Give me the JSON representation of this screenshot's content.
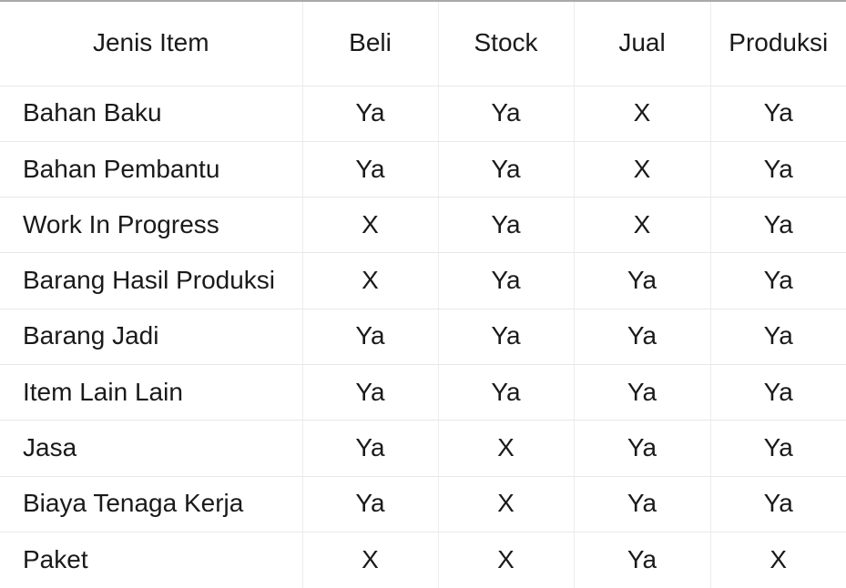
{
  "table": {
    "columns": [
      {
        "key": "label",
        "header": "Jenis Item",
        "align": "left"
      },
      {
        "key": "beli",
        "header": "Beli",
        "align": "center"
      },
      {
        "key": "stock",
        "header": "Stock",
        "align": "center"
      },
      {
        "key": "jual",
        "header": "Jual",
        "align": "center"
      },
      {
        "key": "produksi",
        "header": "Produksi",
        "align": "center"
      }
    ],
    "rows": [
      {
        "label": "Bahan Baku",
        "beli": "Ya",
        "stock": "Ya",
        "jual": "X",
        "produksi": "Ya"
      },
      {
        "label": "Bahan Pembantu",
        "beli": "Ya",
        "stock": "Ya",
        "jual": "X",
        "produksi": "Ya"
      },
      {
        "label": "Work In Progress",
        "beli": "X",
        "stock": "Ya",
        "jual": "X",
        "produksi": "Ya"
      },
      {
        "label": "Barang Hasil Produksi",
        "beli": "X",
        "stock": "Ya",
        "jual": "Ya",
        "produksi": "Ya"
      },
      {
        "label": "Barang Jadi",
        "beli": "Ya",
        "stock": "Ya",
        "jual": "Ya",
        "produksi": "Ya"
      },
      {
        "label": "Item Lain Lain",
        "beli": "Ya",
        "stock": "Ya",
        "jual": "Ya",
        "produksi": "Ya"
      },
      {
        "label": "Jasa",
        "beli": "Ya",
        "stock": "X",
        "jual": "Ya",
        "produksi": "Ya"
      },
      {
        "label": "Biaya Tenaga Kerja",
        "beli": "Ya",
        "stock": "X",
        "jual": "Ya",
        "produksi": "Ya"
      },
      {
        "label": "Paket",
        "beli": "X",
        "stock": "X",
        "jual": "Ya",
        "produksi": "X"
      }
    ]
  },
  "style": {
    "text_color": "#1a1a1a",
    "grid_color": "#e8e8e8",
    "top_border_color": "#a9a9a9",
    "background": "#ffffff"
  }
}
